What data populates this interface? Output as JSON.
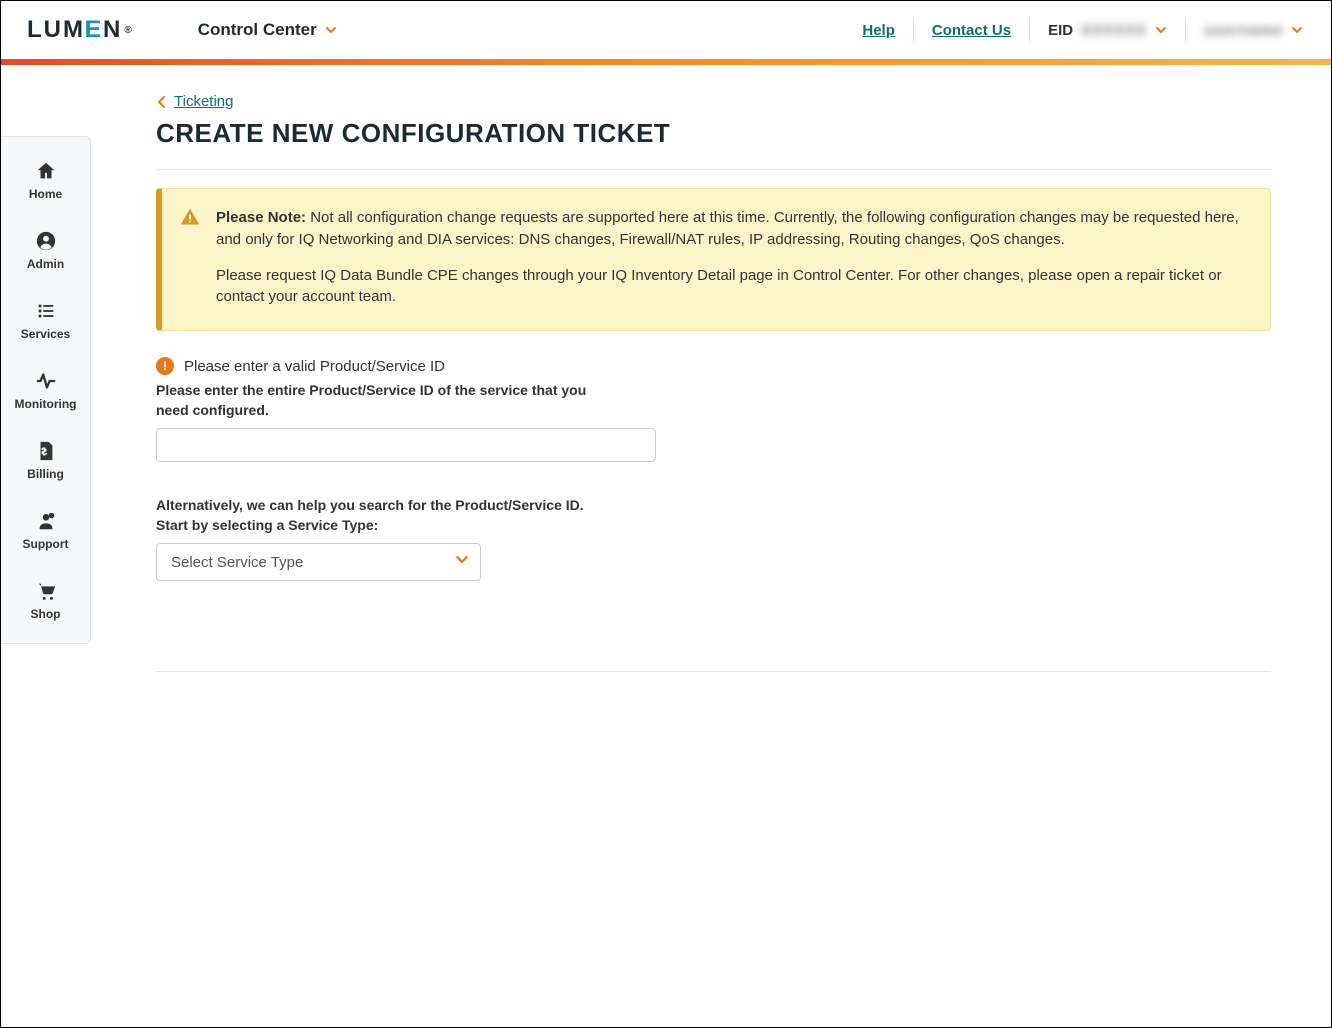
{
  "header": {
    "brand_pre": "LUM",
    "brand_e": "E",
    "brand_post": "N",
    "brand_reg": "®",
    "control_center": "Control Center",
    "help": "Help",
    "contact": "Contact Us",
    "eid_label": "EID",
    "eid_value": "XXXXXX",
    "user_value": "username"
  },
  "sidebar": {
    "items": [
      {
        "label": "Home"
      },
      {
        "label": "Admin"
      },
      {
        "label": "Services"
      },
      {
        "label": "Monitoring"
      },
      {
        "label": "Billing"
      },
      {
        "label": "Support"
      },
      {
        "label": "Shop"
      }
    ]
  },
  "breadcrumb": {
    "parent": "Ticketing"
  },
  "page_title": "CREATE NEW CONFIGURATION TICKET",
  "note": {
    "bold": "Please Note:",
    "p1": " Not all configuration change requests are supported here at this time. Currently, the following configuration changes may be requested here, and only for IQ Networking and DIA services: DNS changes, Firewall/NAT rules, IP addressing, Routing changes, QoS changes.",
    "p2": "Please request IQ Data Bundle CPE changes through your IQ Inventory Detail page in Control Center. For other changes, please open a repair ticket or contact your account team."
  },
  "error_text": "Please enter a valid Product/Service ID",
  "field1_label": "Please enter the entire Product/Service ID of the service that you need configured.",
  "field2_label": "Alternatively, we can help you search for the Product/Service ID. Start by selecting a Service Type:",
  "select_placeholder": "Select Service Type"
}
